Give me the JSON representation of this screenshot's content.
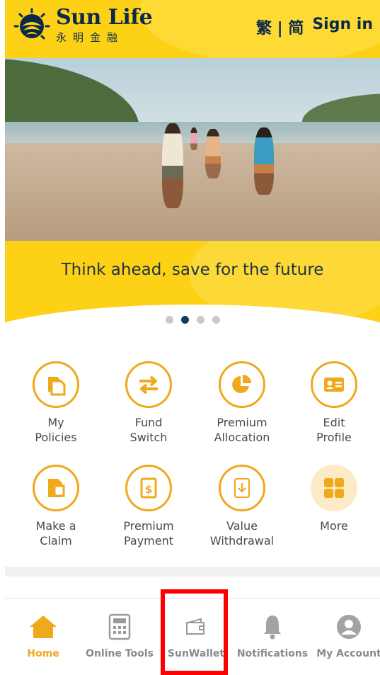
{
  "header": {
    "brand_name": "Sun Life",
    "brand_chinese": "永明金融",
    "language_toggle": "繁 | 简",
    "signin_label": "Sign in"
  },
  "banner": {
    "tagline": "Think ahead, save for the future",
    "carousel_count": 4,
    "carousel_active_index": 1
  },
  "actions": [
    {
      "line1": "My",
      "line2": "Policies",
      "icon": "policies-icon"
    },
    {
      "line1": "Fund",
      "line2": "Switch",
      "icon": "switch-arrows-icon"
    },
    {
      "line1": "Premium",
      "line2": "Allocation",
      "icon": "pie-chart-icon"
    },
    {
      "line1": "Edit",
      "line2": "Profile",
      "icon": "profile-card-icon"
    },
    {
      "line1": "Make a",
      "line2": "Claim",
      "icon": "claim-document-icon"
    },
    {
      "line1": "Premium",
      "line2": "Payment",
      "icon": "dollar-bill-icon"
    },
    {
      "line1": "Value",
      "line2": "Withdrawal",
      "icon": "withdraw-icon"
    },
    {
      "line1": "More",
      "line2": "",
      "icon": "grid-icon"
    }
  ],
  "bottom_nav": [
    {
      "label": "Home",
      "icon": "home-icon",
      "active": true
    },
    {
      "label": "Online Tools",
      "icon": "calculator-icon",
      "active": false
    },
    {
      "label": "SunWallet",
      "icon": "wallet-icon",
      "active": false
    },
    {
      "label": "Notifications",
      "icon": "bell-icon",
      "active": false
    },
    {
      "label": "My Account",
      "icon": "account-icon",
      "active": false
    }
  ],
  "colors": {
    "brand_yellow": "#fcd116",
    "accent_orange": "#f0a81c",
    "navy": "#0b2a4a",
    "highlight_red": "#ff0000"
  }
}
